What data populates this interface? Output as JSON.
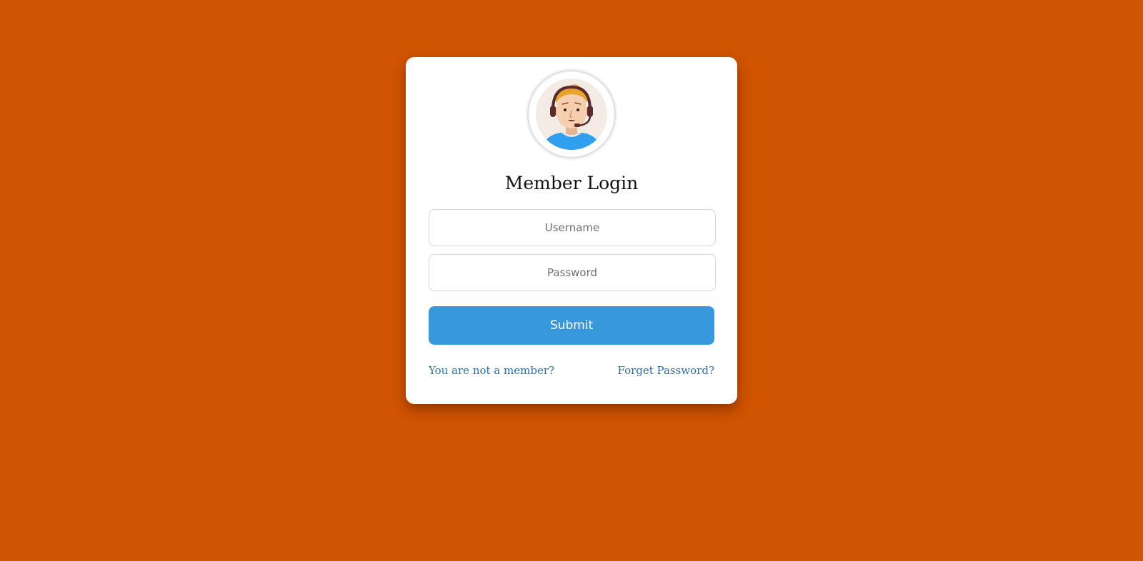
{
  "page": {
    "background_color": "#d15400"
  },
  "login_card": {
    "avatar_icon": "support-agent-headset-avatar",
    "title": "Member Login",
    "username": {
      "placeholder": "Username",
      "value": ""
    },
    "password": {
      "placeholder": "Password",
      "value": ""
    },
    "submit_label": "Submit",
    "submit_color": "#3799db",
    "not_member_link": "You are not a member?",
    "forget_password_link": "Forget Password?",
    "link_color": "#2a6fa8"
  }
}
